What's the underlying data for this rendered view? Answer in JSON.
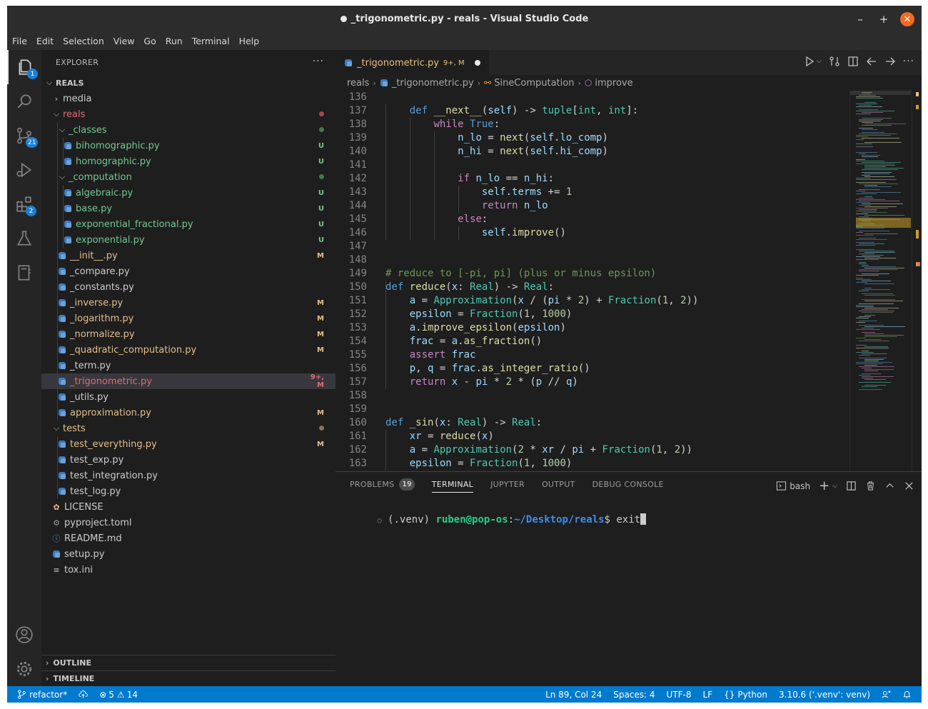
{
  "window": {
    "title": "_trigonometric.py - reals - Visual Studio Code",
    "minimize": "–",
    "maximize": "+",
    "close": "✕"
  },
  "menu": [
    "File",
    "Edit",
    "Selection",
    "View",
    "Go",
    "Run",
    "Terminal",
    "Help"
  ],
  "activity_bar": {
    "explorer_badge": "1",
    "source_control_badge": "21",
    "extensions_badge": "2"
  },
  "sidebar": {
    "title": "EXPLORER",
    "more": "···",
    "root": "REALS",
    "items": [
      {
        "name": "media",
        "type": "folder",
        "open": false,
        "status": "",
        "color": "#cccccc",
        "depth": 0
      },
      {
        "name": "reals",
        "type": "folder",
        "open": true,
        "status": "dot-red",
        "color": "#e06c75",
        "depth": 0
      },
      {
        "name": "_classes",
        "type": "folder",
        "open": true,
        "status": "dot-green",
        "color": "#73c991",
        "depth": 1
      },
      {
        "name": "bihomographic.py",
        "type": "py",
        "status": "U",
        "color": "#73c991",
        "depth": 2
      },
      {
        "name": "homographic.py",
        "type": "py",
        "status": "U",
        "color": "#73c991",
        "depth": 2
      },
      {
        "name": "_computation",
        "type": "folder",
        "open": true,
        "status": "dot-green",
        "color": "#73c991",
        "depth": 1
      },
      {
        "name": "algebraic.py",
        "type": "py",
        "status": "U",
        "color": "#73c991",
        "depth": 2
      },
      {
        "name": "base.py",
        "type": "py",
        "status": "U",
        "color": "#73c991",
        "depth": 2
      },
      {
        "name": "exponential_fractional.py",
        "type": "py",
        "status": "U",
        "color": "#73c991",
        "depth": 2
      },
      {
        "name": "exponential.py",
        "type": "py",
        "status": "U",
        "color": "#73c991",
        "depth": 2
      },
      {
        "name": "__init__.py",
        "type": "py",
        "status": "M",
        "color": "#e2c08d",
        "depth": 1
      },
      {
        "name": "_compare.py",
        "type": "py",
        "status": "",
        "color": "#cccccc",
        "depth": 1
      },
      {
        "name": "_constants.py",
        "type": "py",
        "status": "",
        "color": "#cccccc",
        "depth": 1
      },
      {
        "name": "_inverse.py",
        "type": "py",
        "status": "M",
        "color": "#e2c08d",
        "depth": 1
      },
      {
        "name": "_logarithm.py",
        "type": "py",
        "status": "M",
        "color": "#e2c08d",
        "depth": 1
      },
      {
        "name": "_normalize.py",
        "type": "py",
        "status": "M",
        "color": "#e2c08d",
        "depth": 1
      },
      {
        "name": "_quadratic_computation.py",
        "type": "py",
        "status": "M",
        "color": "#e2c08d",
        "depth": 1
      },
      {
        "name": "_term.py",
        "type": "py",
        "status": "",
        "color": "#cccccc",
        "depth": 1
      },
      {
        "name": "_trigonometric.py",
        "type": "py",
        "status": "9+, M",
        "color": "#e06c75",
        "depth": 1,
        "selected": true
      },
      {
        "name": "_utils.py",
        "type": "py",
        "status": "",
        "color": "#cccccc",
        "depth": 1
      },
      {
        "name": "approximation.py",
        "type": "py",
        "status": "M",
        "color": "#e2c08d",
        "depth": 1
      },
      {
        "name": "tests",
        "type": "folder",
        "open": true,
        "status": "dot-yellow",
        "color": "#e2c08d",
        "depth": 0
      },
      {
        "name": "test_everything.py",
        "type": "py",
        "status": "M",
        "color": "#e2c08d",
        "depth": 1
      },
      {
        "name": "test_exp.py",
        "type": "py",
        "status": "",
        "color": "#cccccc",
        "depth": 1
      },
      {
        "name": "test_integration.py",
        "type": "py",
        "status": "",
        "color": "#cccccc",
        "depth": 1
      },
      {
        "name": "test_log.py",
        "type": "py",
        "status": "",
        "color": "#cccccc",
        "depth": 1
      },
      {
        "name": "LICENSE",
        "type": "license",
        "status": "",
        "color": "#cccccc",
        "depth": 0
      },
      {
        "name": "pyproject.toml",
        "type": "gear",
        "status": "",
        "color": "#cccccc",
        "depth": 0
      },
      {
        "name": "README.md",
        "type": "info",
        "status": "",
        "color": "#cccccc",
        "depth": 0
      },
      {
        "name": "setup.py",
        "type": "py",
        "status": "",
        "color": "#cccccc",
        "depth": 0
      },
      {
        "name": "tox.ini",
        "type": "lines",
        "status": "",
        "color": "#cccccc",
        "depth": 0
      }
    ],
    "outline": "OUTLINE",
    "timeline": "TIMELINE"
  },
  "editor": {
    "tab": {
      "name": "_trigonometric.py",
      "status": "9+, M"
    },
    "breadcrumb": [
      "reals",
      "_trigonometric.py",
      "SineComputation",
      "improve"
    ],
    "lines": [
      {
        "n": "136",
        "tokens": []
      },
      {
        "n": "137",
        "tokens": [
          [
            "    ",
            "d"
          ],
          [
            "def ",
            "k"
          ],
          [
            "__next__",
            "f"
          ],
          [
            "(",
            "d"
          ],
          [
            "self",
            "v"
          ],
          [
            ") -> ",
            "d"
          ],
          [
            "tuple",
            "t"
          ],
          [
            "[",
            "d"
          ],
          [
            "int",
            "t"
          ],
          [
            ", ",
            "d"
          ],
          [
            "int",
            "t"
          ],
          [
            "]:",
            "d"
          ]
        ]
      },
      {
        "n": "138",
        "tokens": [
          [
            "        ",
            "d"
          ],
          [
            "while ",
            "kc"
          ],
          [
            "True",
            "k"
          ],
          [
            ":",
            "d"
          ]
        ]
      },
      {
        "n": "139",
        "tokens": [
          [
            "            ",
            "d"
          ],
          [
            "n_lo",
            "v"
          ],
          [
            " = ",
            "d"
          ],
          [
            "next",
            "f"
          ],
          [
            "(",
            "d"
          ],
          [
            "self",
            "v"
          ],
          [
            ".",
            "d"
          ],
          [
            "lo_comp",
            "v"
          ],
          [
            ")",
            "d"
          ]
        ]
      },
      {
        "n": "140",
        "tokens": [
          [
            "            ",
            "d"
          ],
          [
            "n_hi",
            "v"
          ],
          [
            " = ",
            "d"
          ],
          [
            "next",
            "f"
          ],
          [
            "(",
            "d"
          ],
          [
            "self",
            "v"
          ],
          [
            ".",
            "d"
          ],
          [
            "hi_comp",
            "v"
          ],
          [
            ")",
            "d"
          ]
        ]
      },
      {
        "n": "141",
        "tokens": []
      },
      {
        "n": "142",
        "tokens": [
          [
            "            ",
            "d"
          ],
          [
            "if ",
            "kc"
          ],
          [
            "n_lo",
            "v"
          ],
          [
            " == ",
            "d"
          ],
          [
            "n_hi",
            "v"
          ],
          [
            ":",
            "d"
          ]
        ]
      },
      {
        "n": "143",
        "tokens": [
          [
            "                ",
            "d"
          ],
          [
            "self",
            "v"
          ],
          [
            ".",
            "d"
          ],
          [
            "terms",
            "v"
          ],
          [
            " += ",
            "d"
          ],
          [
            "1",
            "n"
          ]
        ]
      },
      {
        "n": "144",
        "tokens": [
          [
            "                ",
            "d"
          ],
          [
            "return ",
            "kc"
          ],
          [
            "n_lo",
            "v"
          ]
        ]
      },
      {
        "n": "145",
        "tokens": [
          [
            "            ",
            "d"
          ],
          [
            "else",
            "kc"
          ],
          [
            ":",
            "d"
          ]
        ]
      },
      {
        "n": "146",
        "tokens": [
          [
            "                ",
            "d"
          ],
          [
            "self",
            "v"
          ],
          [
            ".",
            "d"
          ],
          [
            "improve",
            "f"
          ],
          [
            "()",
            "d"
          ]
        ]
      },
      {
        "n": "147",
        "tokens": []
      },
      {
        "n": "148",
        "tokens": []
      },
      {
        "n": "149",
        "tokens": [
          [
            "# reduce to [-pi, pi] (plus or minus epsilon)",
            "c"
          ]
        ]
      },
      {
        "n": "150",
        "tokens": [
          [
            "def ",
            "k"
          ],
          [
            "reduce",
            "f"
          ],
          [
            "(",
            "d"
          ],
          [
            "x",
            "v"
          ],
          [
            ": ",
            "d"
          ],
          [
            "Real",
            "t"
          ],
          [
            ") -> ",
            "d"
          ],
          [
            "Real",
            "t"
          ],
          [
            ":",
            "d"
          ]
        ]
      },
      {
        "n": "151",
        "tokens": [
          [
            "    ",
            "d"
          ],
          [
            "a",
            "v"
          ],
          [
            " = ",
            "d"
          ],
          [
            "Approximation",
            "t"
          ],
          [
            "(",
            "d"
          ],
          [
            "x",
            "v"
          ],
          [
            " / (",
            "d"
          ],
          [
            "pi",
            "v"
          ],
          [
            " * ",
            "d"
          ],
          [
            "2",
            "n"
          ],
          [
            ") + ",
            "d"
          ],
          [
            "Fraction",
            "t"
          ],
          [
            "(",
            "d"
          ],
          [
            "1",
            "n"
          ],
          [
            ", ",
            "d"
          ],
          [
            "2",
            "n"
          ],
          [
            "))",
            "d"
          ]
        ]
      },
      {
        "n": "152",
        "tokens": [
          [
            "    ",
            "d"
          ],
          [
            "epsilon",
            "v"
          ],
          [
            " = ",
            "d"
          ],
          [
            "Fraction",
            "t"
          ],
          [
            "(",
            "d"
          ],
          [
            "1",
            "n"
          ],
          [
            ", ",
            "d"
          ],
          [
            "1000",
            "n"
          ],
          [
            ")",
            "d"
          ]
        ]
      },
      {
        "n": "153",
        "tokens": [
          [
            "    ",
            "d"
          ],
          [
            "a",
            "v"
          ],
          [
            ".",
            "d"
          ],
          [
            "improve_epsilon",
            "f"
          ],
          [
            "(",
            "d"
          ],
          [
            "epsilon",
            "v"
          ],
          [
            ")",
            "d"
          ]
        ]
      },
      {
        "n": "154",
        "tokens": [
          [
            "    ",
            "d"
          ],
          [
            "frac",
            "v"
          ],
          [
            " = ",
            "d"
          ],
          [
            "a",
            "v"
          ],
          [
            ".",
            "d"
          ],
          [
            "as_fraction",
            "f"
          ],
          [
            "()",
            "d"
          ]
        ]
      },
      {
        "n": "155",
        "tokens": [
          [
            "    ",
            "d"
          ],
          [
            "assert ",
            "kc"
          ],
          [
            "frac",
            "v"
          ]
        ]
      },
      {
        "n": "156",
        "tokens": [
          [
            "    ",
            "d"
          ],
          [
            "p",
            "v"
          ],
          [
            ", ",
            "d"
          ],
          [
            "q",
            "v"
          ],
          [
            " = ",
            "d"
          ],
          [
            "frac",
            "v"
          ],
          [
            ".",
            "d"
          ],
          [
            "as_integer_ratio",
            "f"
          ],
          [
            "()",
            "d"
          ]
        ]
      },
      {
        "n": "157",
        "tokens": [
          [
            "    ",
            "d"
          ],
          [
            "return ",
            "kc"
          ],
          [
            "x",
            "v"
          ],
          [
            " - ",
            "d"
          ],
          [
            "pi",
            "v"
          ],
          [
            " * ",
            "d"
          ],
          [
            "2",
            "n"
          ],
          [
            " * (",
            "d"
          ],
          [
            "p",
            "v"
          ],
          [
            " // ",
            "d"
          ],
          [
            "q",
            "v"
          ],
          [
            ")",
            "d"
          ]
        ]
      },
      {
        "n": "158",
        "tokens": []
      },
      {
        "n": "159",
        "tokens": []
      },
      {
        "n": "160",
        "tokens": [
          [
            "def ",
            "k"
          ],
          [
            "_sin",
            "f"
          ],
          [
            "(",
            "d"
          ],
          [
            "x",
            "v"
          ],
          [
            ": ",
            "d"
          ],
          [
            "Real",
            "t"
          ],
          [
            ") -> ",
            "d"
          ],
          [
            "Real",
            "t"
          ],
          [
            ":",
            "d"
          ]
        ]
      },
      {
        "n": "161",
        "tokens": [
          [
            "    ",
            "d"
          ],
          [
            "xr",
            "v"
          ],
          [
            " = ",
            "d"
          ],
          [
            "reduce",
            "f"
          ],
          [
            "(",
            "d"
          ],
          [
            "x",
            "v"
          ],
          [
            ")",
            "d"
          ]
        ]
      },
      {
        "n": "162",
        "tokens": [
          [
            "    ",
            "d"
          ],
          [
            "a",
            "v"
          ],
          [
            " = ",
            "d"
          ],
          [
            "Approximation",
            "t"
          ],
          [
            "(",
            "d"
          ],
          [
            "2",
            "n"
          ],
          [
            " * ",
            "d"
          ],
          [
            "xr",
            "v"
          ],
          [
            " / ",
            "d"
          ],
          [
            "pi",
            "v"
          ],
          [
            " + ",
            "d"
          ],
          [
            "Fraction",
            "t"
          ],
          [
            "(",
            "d"
          ],
          [
            "1",
            "n"
          ],
          [
            ", ",
            "d"
          ],
          [
            "2",
            "n"
          ],
          [
            "))",
            "d"
          ]
        ]
      },
      {
        "n": "163",
        "tokens": [
          [
            "    ",
            "d"
          ],
          [
            "epsilon",
            "v"
          ],
          [
            " = ",
            "d"
          ],
          [
            "Fraction",
            "t"
          ],
          [
            "(",
            "d"
          ],
          [
            "1",
            "n"
          ],
          [
            ", ",
            "d"
          ],
          [
            "1000",
            "n"
          ],
          [
            ")",
            "d"
          ]
        ]
      }
    ]
  },
  "panel": {
    "tabs": [
      "PROBLEMS",
      "TERMINAL",
      "JUPYTER",
      "OUTPUT",
      "DEBUG CONSOLE"
    ],
    "problems_count": "19",
    "active_tab": "TERMINAL",
    "shell": "bash",
    "terminal": {
      "env": "(.venv) ",
      "user_host": "ruben@pop-os",
      "sep": ":",
      "path": "~/Desktop/reals",
      "prompt": "$ ",
      "command": "exit"
    }
  },
  "statusbar": {
    "branch": "refactor*",
    "errors": "5",
    "warnings": "14",
    "position": "Ln 89, Col 24",
    "spaces": "Spaces: 4",
    "encoding": "UTF-8",
    "eol": "LF",
    "language": "Python",
    "interpreter": "3.10.6 ('.venv': venv)"
  },
  "colors": {
    "accent": "#007acc",
    "modified": "#e2c08d",
    "untracked": "#73c991",
    "error": "#e06c75"
  }
}
